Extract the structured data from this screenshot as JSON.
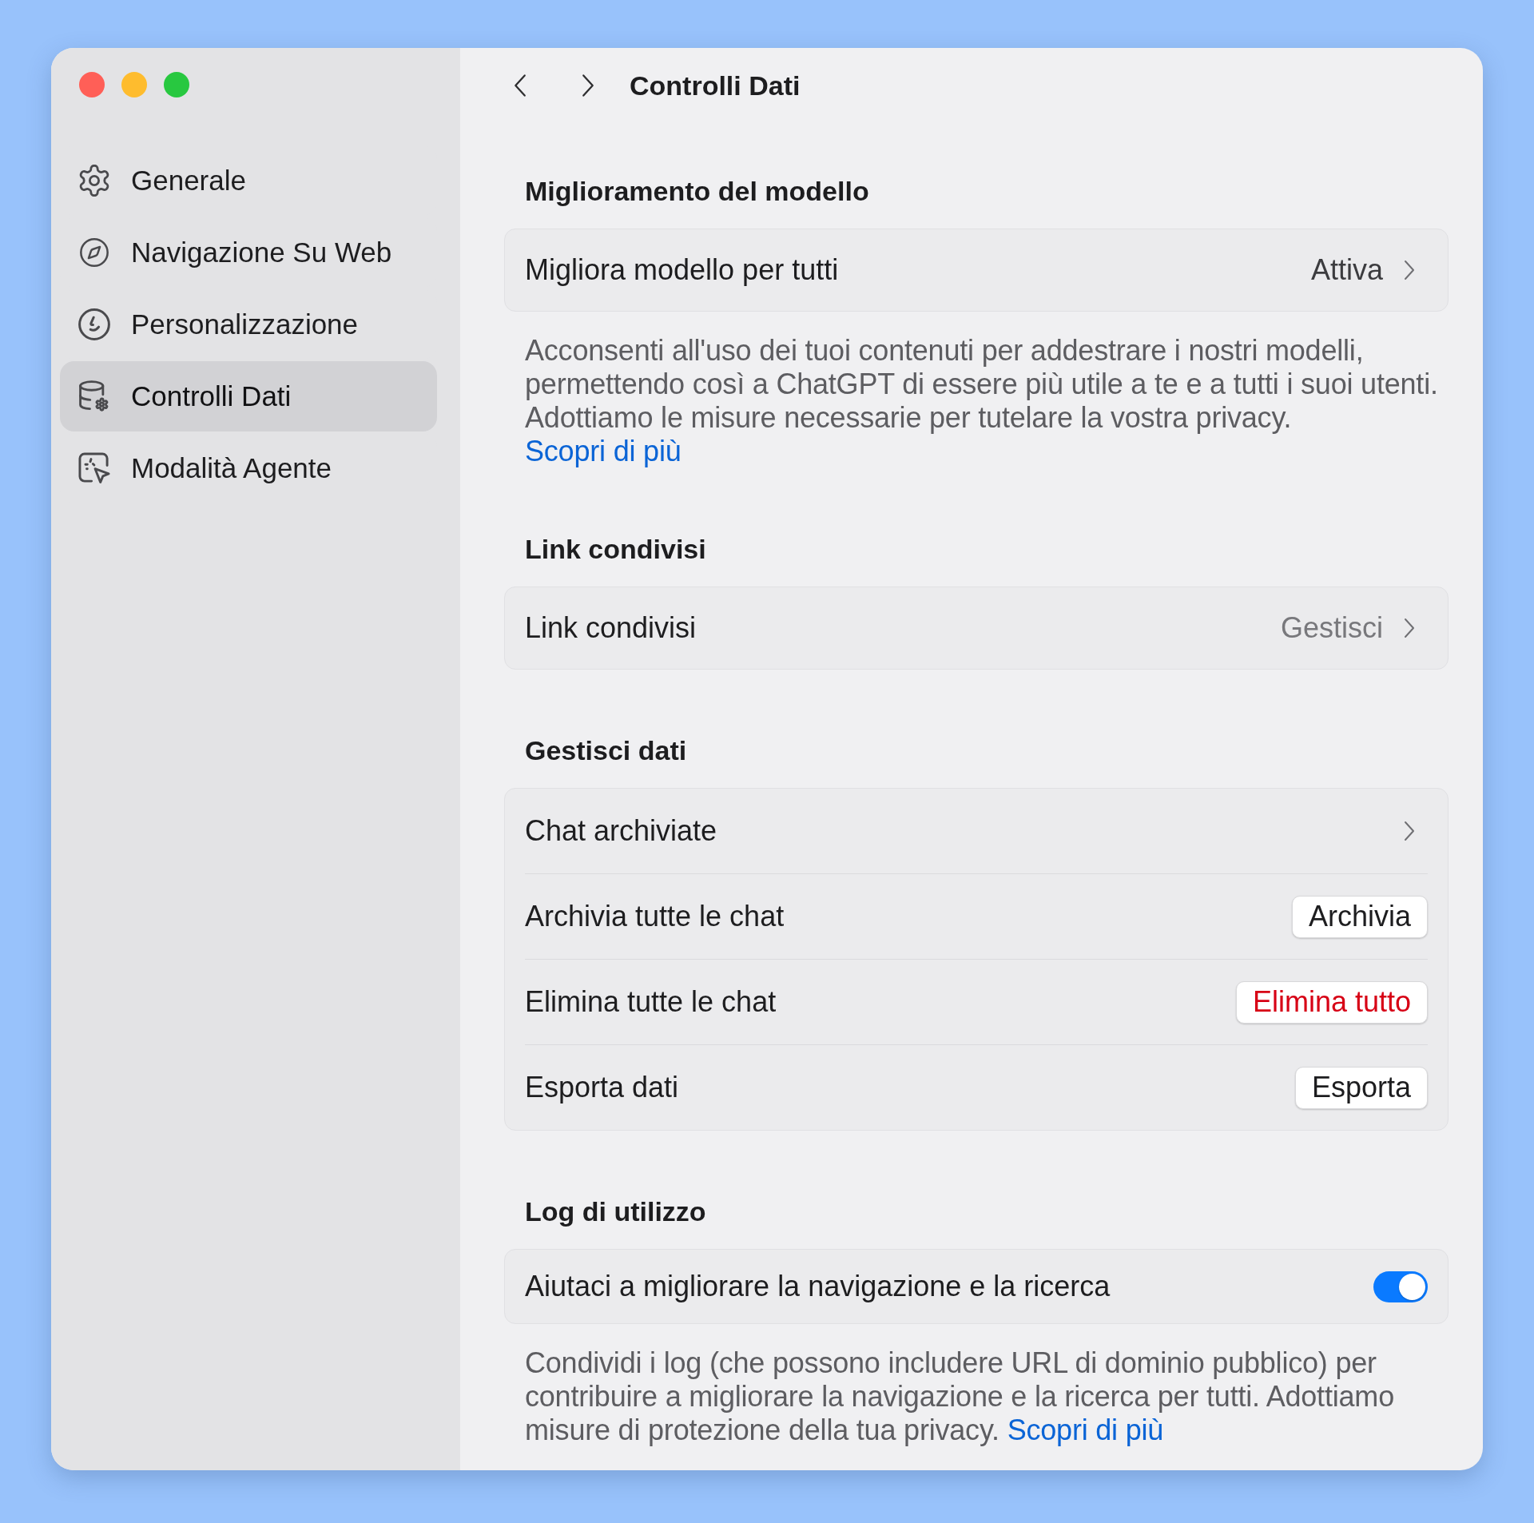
{
  "window": {
    "title": "Controlli Dati"
  },
  "sidebar": {
    "items": [
      {
        "label": "Generale",
        "selected": false
      },
      {
        "label": "Navigazione Su Web",
        "selected": false
      },
      {
        "label": "Personalizzazione",
        "selected": false
      },
      {
        "label": "Controlli Dati",
        "selected": true
      },
      {
        "label": "Modalità Agente",
        "selected": false
      }
    ]
  },
  "sections": [
    {
      "heading": "Miglioramento del modello",
      "rows": [
        {
          "kind": "link",
          "label": "Migliora modello per tutti",
          "value": "Attiva",
          "dimmed": false
        }
      ],
      "note": {
        "text": "Acconsenti all'uso dei tuoi contenuti per addestrare i nostri modelli, permettendo così a ChatGPT di essere più utile a te e a tutti i suoi utenti. Adottiamo le misure necessarie per tutelare la vostra privacy.",
        "link": "Scopri di più"
      }
    },
    {
      "heading": "Link condivisi",
      "rows": [
        {
          "kind": "link",
          "label": "Link condivisi",
          "value": "Gestisci",
          "dimmed": true
        }
      ]
    },
    {
      "heading": "Gestisci dati",
      "rows": [
        {
          "kind": "link",
          "label": "Chat archiviate"
        },
        {
          "kind": "button",
          "label": "Archivia tutte le chat",
          "button": {
            "label": "Archivia",
            "destructive": false
          }
        },
        {
          "kind": "button",
          "label": "Elimina tutte le chat",
          "button": {
            "label": "Elimina tutto",
            "destructive": true
          }
        },
        {
          "kind": "button",
          "label": "Esporta dati",
          "button": {
            "label": "Esporta",
            "destructive": false
          }
        }
      ]
    },
    {
      "heading": "Log di utilizzo",
      "rows": [
        {
          "kind": "toggle",
          "label": "Aiutaci a migliorare la navigazione e la ricerca",
          "on": true
        }
      ],
      "note": {
        "text": "Condividi i log (che possono includere URL di dominio pubblico) per contribuire a migliorare la navigazione e la ricerca per tutti. Adottiamo misure di protezione della tua privacy.",
        "link": "Scopri di più"
      }
    }
  ]
}
